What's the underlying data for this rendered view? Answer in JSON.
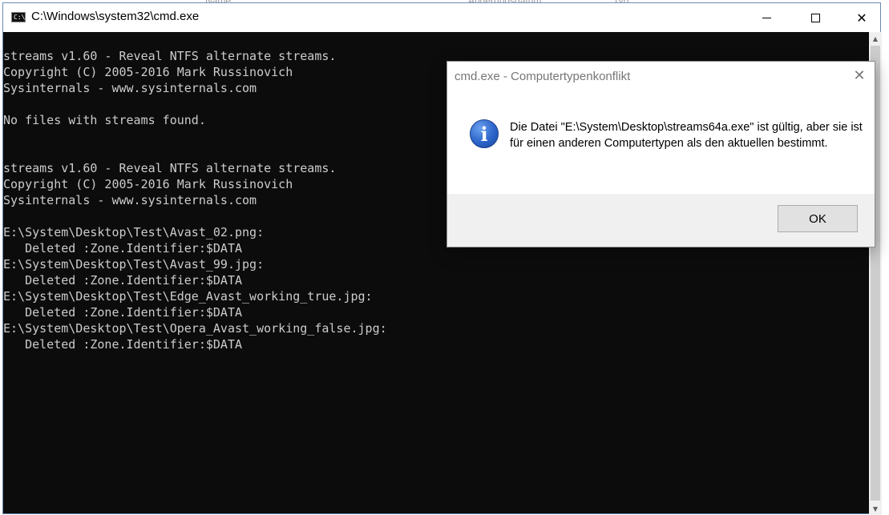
{
  "window": {
    "title": "C:\\Windows\\system32\\cmd.exe",
    "icon_text": "C:\\",
    "icon": "console-icon",
    "minimize_glyph": "—",
    "maximize_glyph": "☐",
    "close_glyph": "✕"
  },
  "console": {
    "lines": [
      "streams v1.60 - Reveal NTFS alternate streams.",
      "Copyright (C) 2005-2016 Mark Russinovich",
      "Sysinternals - www.sysinternals.com",
      "",
      "No files with streams found.",
      "",
      "",
      "streams v1.60 - Reveal NTFS alternate streams.",
      "Copyright (C) 2005-2016 Mark Russinovich",
      "Sysinternals - www.sysinternals.com",
      "",
      "E:\\System\\Desktop\\Test\\Avast_02.png:",
      "   Deleted :Zone.Identifier:$DATA",
      "E:\\System\\Desktop\\Test\\Avast_99.jpg:",
      "   Deleted :Zone.Identifier:$DATA",
      "E:\\System\\Desktop\\Test\\Edge_Avast_working_true.jpg:",
      "   Deleted :Zone.Identifier:$DATA",
      "E:\\System\\Desktop\\Test\\Opera_Avast_working_false.jpg:",
      "   Deleted :Zone.Identifier:$DATA"
    ],
    "text_color": "#cccccc",
    "background": "#0c0c0c"
  },
  "background_window": {
    "header_name": "Name",
    "header_date": "Änderungsdatum",
    "header_type": "Typ"
  },
  "dialog": {
    "title": "cmd.exe - Computertypenkonflikt",
    "close_glyph": "✕",
    "icon": "info-icon",
    "icon_glyph": "i",
    "message": "Die Datei \"E:\\System\\Desktop\\streams64a.exe\" ist gültig, aber sie ist für einen anderen Computertypen als den aktuellen bestimmt.",
    "ok_label": "OK"
  }
}
